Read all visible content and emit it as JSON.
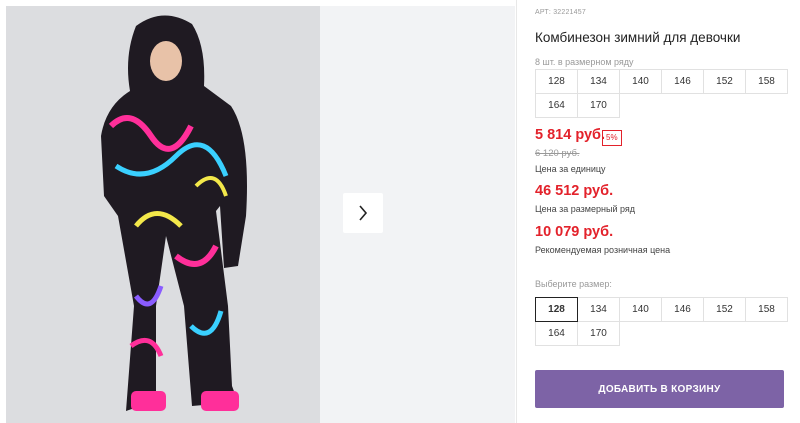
{
  "product": {
    "article": "АРТ: 32221457",
    "title": "Комбинезон зимний для девочки",
    "size_range_hint": "8 шт. в размерном ряду",
    "size_range": [
      "128",
      "134",
      "140",
      "146",
      "152",
      "158",
      "164",
      "170"
    ],
    "price": "5 814 руб.",
    "discount_badge": "5%",
    "old_price": "6 120 руб.",
    "price_note": "Цена за единицу",
    "row_price": "46 512 руб.",
    "row_price_note": "Цена за размерный ряд",
    "retail_price": "10 079 руб.",
    "retail_price_note": "Рекомендуемая розничная цена",
    "choose_size_label": "Выберите размер:",
    "sizes": [
      "128",
      "134",
      "140",
      "146",
      "152",
      "158",
      "164",
      "170"
    ],
    "selected_size": "128",
    "add_to_cart_label": "ДОБАВИТЬ В КОРЗИНУ"
  },
  "colors": {
    "accent_red": "#e3222b",
    "cta_purple": "#7d63a6"
  },
  "icons": {
    "next": "chevron-right-icon"
  }
}
